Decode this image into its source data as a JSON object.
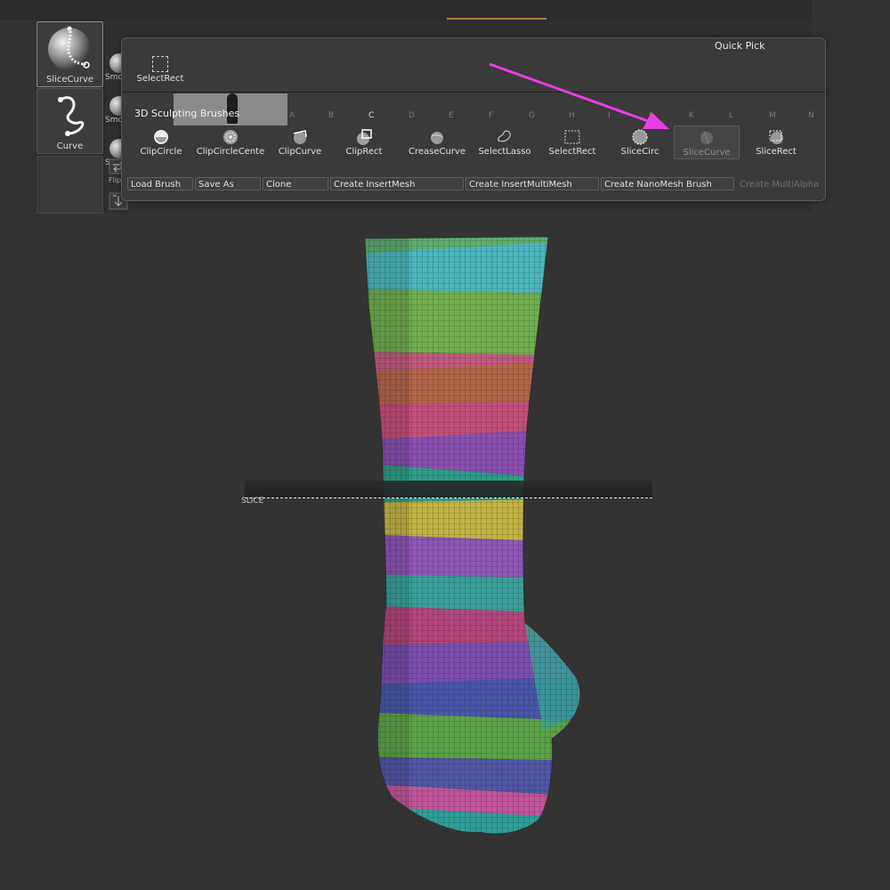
{
  "quick_pick": {
    "title": "Quick Pick",
    "item_label": "SelectRect"
  },
  "left_tray": {
    "slots": [
      {
        "label": "SliceCurve"
      },
      {
        "label": "Curve"
      }
    ],
    "smooth_labels": [
      "Smo",
      "Smoot",
      "Smo"
    ],
    "flip_label": "Flip"
  },
  "sculpting": {
    "title": "3D Sculpting Brushes",
    "letters": [
      "A",
      "B",
      "C",
      "D",
      "E",
      "F",
      "G",
      "H",
      "I",
      "J",
      "K",
      "L",
      "M",
      "N"
    ],
    "brushes": [
      {
        "label": "ClipCircle",
        "icon": "clip-circle-icon"
      },
      {
        "label": "ClipCircleCente",
        "icon": "clip-circle-center-icon"
      },
      {
        "label": "ClipCurve",
        "icon": "clip-curve-icon"
      },
      {
        "label": "ClipRect",
        "icon": "clip-rect-icon"
      },
      {
        "label": "CreaseCurve",
        "icon": "crease-curve-icon"
      },
      {
        "label": "SelectLasso",
        "icon": "select-lasso-icon"
      },
      {
        "label": "SelectRect",
        "icon": "select-rect-icon"
      },
      {
        "label": "SliceCirc",
        "icon": "slice-circle-icon"
      },
      {
        "label": "SliceCurve",
        "icon": "slice-curve-icon"
      },
      {
        "label": "SliceRect",
        "icon": "slice-rect-icon"
      }
    ]
  },
  "buttons": {
    "load_brush": "Load Brush",
    "save_as": "Save As",
    "clone": "Clone",
    "create_insert_mesh": "Create InsertMesh",
    "create_insert_multimesh": "Create InsertMultiMesh",
    "create_nanomesh": "Create NanoMesh Brush",
    "create_multialpha": "Create MultiAlpha"
  },
  "viewport": {
    "slice_label": "SLICE"
  },
  "colors": {
    "annotation_arrow": "#e83ee8",
    "accent_grip": "#b07d45"
  }
}
